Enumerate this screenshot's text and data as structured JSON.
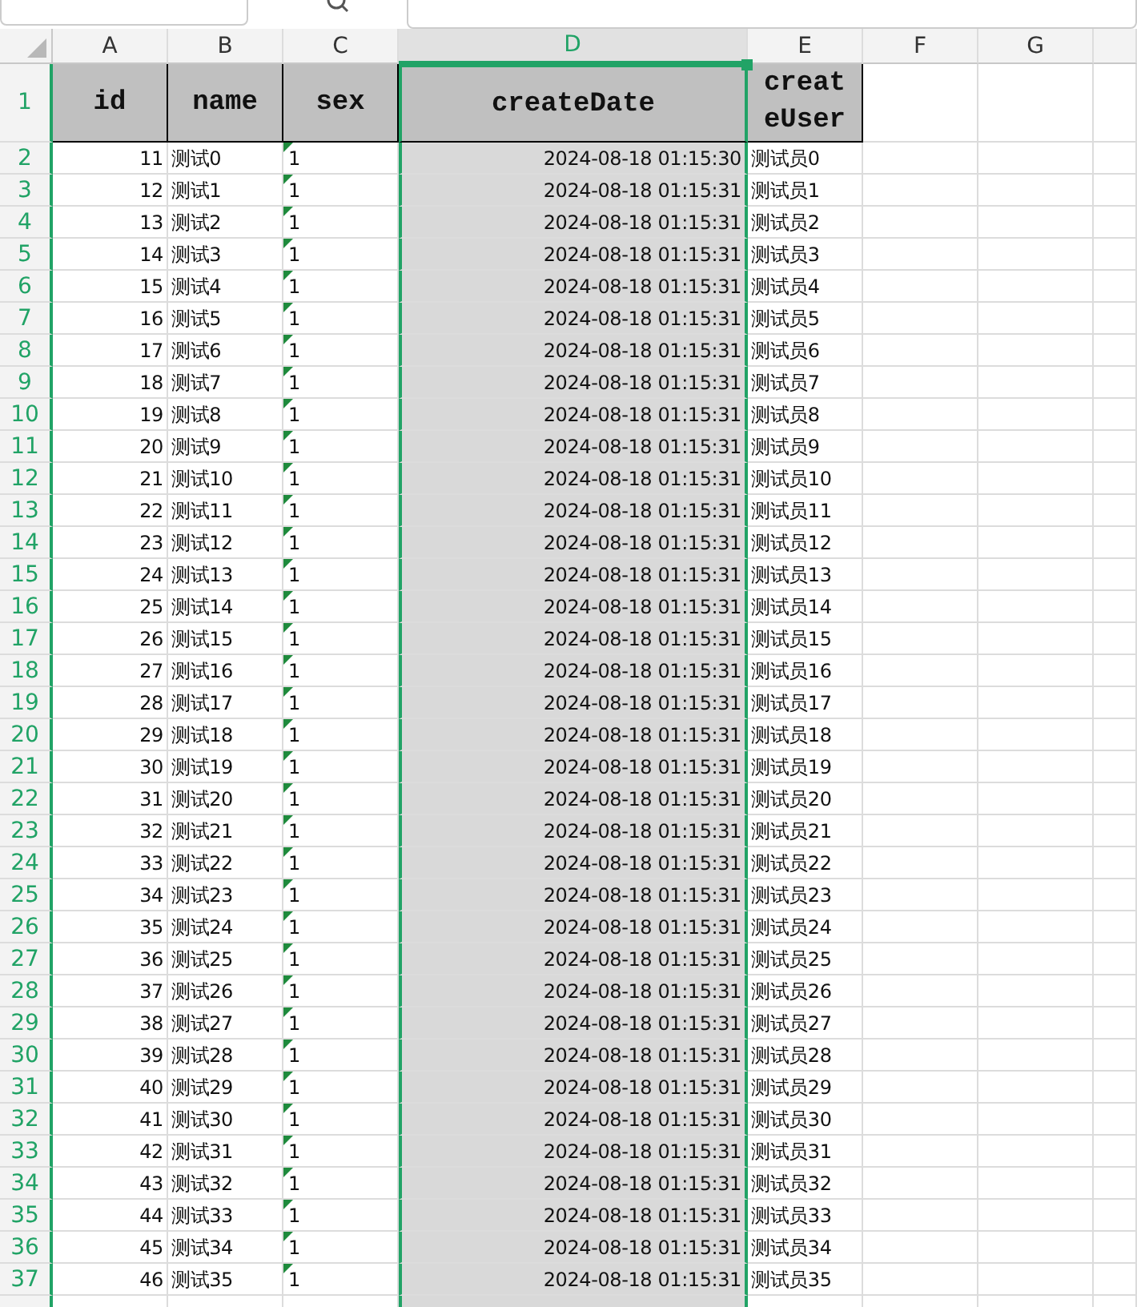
{
  "column_headers": [
    {
      "label": "A",
      "selected": false
    },
    {
      "label": "B",
      "selected": false
    },
    {
      "label": "C",
      "selected": false
    },
    {
      "label": "D",
      "selected": true
    },
    {
      "label": "E",
      "selected": false
    },
    {
      "label": "F",
      "selected": false
    },
    {
      "label": "G",
      "selected": false
    }
  ],
  "header_row": {
    "row_number": "1",
    "cells": [
      "id",
      "name",
      "sex",
      "createDate",
      "createUser"
    ]
  },
  "rows": [
    {
      "row_number": "2",
      "id": "11",
      "name": "测试0",
      "sex": "1",
      "sex_flagged": true,
      "createDate": "2024-08-18 01:15:30",
      "createUser": "测试员0"
    },
    {
      "row_number": "3",
      "id": "12",
      "name": "测试1",
      "sex": "1",
      "sex_flagged": true,
      "createDate": "2024-08-18 01:15:31",
      "createUser": "测试员1"
    },
    {
      "row_number": "4",
      "id": "13",
      "name": "测试2",
      "sex": "1",
      "sex_flagged": true,
      "createDate": "2024-08-18 01:15:31",
      "createUser": "测试员2"
    },
    {
      "row_number": "5",
      "id": "14",
      "name": "测试3",
      "sex": "1",
      "sex_flagged": true,
      "createDate": "2024-08-18 01:15:31",
      "createUser": "测试员3"
    },
    {
      "row_number": "6",
      "id": "15",
      "name": "测试4",
      "sex": "1",
      "sex_flagged": true,
      "createDate": "2024-08-18 01:15:31",
      "createUser": "测试员4"
    },
    {
      "row_number": "7",
      "id": "16",
      "name": "测试5",
      "sex": "1",
      "sex_flagged": true,
      "createDate": "2024-08-18 01:15:31",
      "createUser": "测试员5"
    },
    {
      "row_number": "8",
      "id": "17",
      "name": "测试6",
      "sex": "1",
      "sex_flagged": true,
      "createDate": "2024-08-18 01:15:31",
      "createUser": "测试员6"
    },
    {
      "row_number": "9",
      "id": "18",
      "name": "测试7",
      "sex": "1",
      "sex_flagged": true,
      "createDate": "2024-08-18 01:15:31",
      "createUser": "测试员7"
    },
    {
      "row_number": "10",
      "id": "19",
      "name": "测试8",
      "sex": "1",
      "sex_flagged": true,
      "createDate": "2024-08-18 01:15:31",
      "createUser": "测试员8"
    },
    {
      "row_number": "11",
      "id": "20",
      "name": "测试9",
      "sex": "1",
      "sex_flagged": true,
      "createDate": "2024-08-18 01:15:31",
      "createUser": "测试员9"
    },
    {
      "row_number": "12",
      "id": "21",
      "name": "测试10",
      "sex": "1",
      "sex_flagged": true,
      "createDate": "2024-08-18 01:15:31",
      "createUser": "测试员10"
    },
    {
      "row_number": "13",
      "id": "22",
      "name": "测试11",
      "sex": "1",
      "sex_flagged": true,
      "createDate": "2024-08-18 01:15:31",
      "createUser": "测试员11"
    },
    {
      "row_number": "14",
      "id": "23",
      "name": "测试12",
      "sex": "1",
      "sex_flagged": true,
      "createDate": "2024-08-18 01:15:31",
      "createUser": "测试员12"
    },
    {
      "row_number": "15",
      "id": "24",
      "name": "测试13",
      "sex": "1",
      "sex_flagged": true,
      "createDate": "2024-08-18 01:15:31",
      "createUser": "测试员13"
    },
    {
      "row_number": "16",
      "id": "25",
      "name": "测试14",
      "sex": "1",
      "sex_flagged": true,
      "createDate": "2024-08-18 01:15:31",
      "createUser": "测试员14"
    },
    {
      "row_number": "17",
      "id": "26",
      "name": "测试15",
      "sex": "1",
      "sex_flagged": true,
      "createDate": "2024-08-18 01:15:31",
      "createUser": "测试员15"
    },
    {
      "row_number": "18",
      "id": "27",
      "name": "测试16",
      "sex": "1",
      "sex_flagged": true,
      "createDate": "2024-08-18 01:15:31",
      "createUser": "测试员16"
    },
    {
      "row_number": "19",
      "id": "28",
      "name": "测试17",
      "sex": "1",
      "sex_flagged": true,
      "createDate": "2024-08-18 01:15:31",
      "createUser": "测试员17"
    },
    {
      "row_number": "20",
      "id": "29",
      "name": "测试18",
      "sex": "1",
      "sex_flagged": true,
      "createDate": "2024-08-18 01:15:31",
      "createUser": "测试员18"
    },
    {
      "row_number": "21",
      "id": "30",
      "name": "测试19",
      "sex": "1",
      "sex_flagged": true,
      "createDate": "2024-08-18 01:15:31",
      "createUser": "测试员19"
    },
    {
      "row_number": "22",
      "id": "31",
      "name": "测试20",
      "sex": "1",
      "sex_flagged": true,
      "createDate": "2024-08-18 01:15:31",
      "createUser": "测试员20"
    },
    {
      "row_number": "23",
      "id": "32",
      "name": "测试21",
      "sex": "1",
      "sex_flagged": true,
      "createDate": "2024-08-18 01:15:31",
      "createUser": "测试员21"
    },
    {
      "row_number": "24",
      "id": "33",
      "name": "测试22",
      "sex": "1",
      "sex_flagged": true,
      "createDate": "2024-08-18 01:15:31",
      "createUser": "测试员22"
    },
    {
      "row_number": "25",
      "id": "34",
      "name": "测试23",
      "sex": "1",
      "sex_flagged": true,
      "createDate": "2024-08-18 01:15:31",
      "createUser": "测试员23"
    },
    {
      "row_number": "26",
      "id": "35",
      "name": "测试24",
      "sex": "1",
      "sex_flagged": true,
      "createDate": "2024-08-18 01:15:31",
      "createUser": "测试员24"
    },
    {
      "row_number": "27",
      "id": "36",
      "name": "测试25",
      "sex": "1",
      "sex_flagged": true,
      "createDate": "2024-08-18 01:15:31",
      "createUser": "测试员25"
    },
    {
      "row_number": "28",
      "id": "37",
      "name": "测试26",
      "sex": "1",
      "sex_flagged": true,
      "createDate": "2024-08-18 01:15:31",
      "createUser": "测试员26"
    },
    {
      "row_number": "29",
      "id": "38",
      "name": "测试27",
      "sex": "1",
      "sex_flagged": true,
      "createDate": "2024-08-18 01:15:31",
      "createUser": "测试员27"
    },
    {
      "row_number": "30",
      "id": "39",
      "name": "测试28",
      "sex": "1",
      "sex_flagged": true,
      "createDate": "2024-08-18 01:15:31",
      "createUser": "测试员28"
    },
    {
      "row_number": "31",
      "id": "40",
      "name": "测试29",
      "sex": "1",
      "sex_flagged": true,
      "createDate": "2024-08-18 01:15:31",
      "createUser": "测试员29"
    },
    {
      "row_number": "32",
      "id": "41",
      "name": "测试30",
      "sex": "1",
      "sex_flagged": true,
      "createDate": "2024-08-18 01:15:31",
      "createUser": "测试员30"
    },
    {
      "row_number": "33",
      "id": "42",
      "name": "测试31",
      "sex": "1",
      "sex_flagged": true,
      "createDate": "2024-08-18 01:15:31",
      "createUser": "测试员31"
    },
    {
      "row_number": "34",
      "id": "43",
      "name": "测试32",
      "sex": "1",
      "sex_flagged": true,
      "createDate": "2024-08-18 01:15:31",
      "createUser": "测试员32"
    },
    {
      "row_number": "35",
      "id": "44",
      "name": "测试33",
      "sex": "1",
      "sex_flagged": true,
      "createDate": "2024-08-18 01:15:31",
      "createUser": "测试员33"
    },
    {
      "row_number": "36",
      "id": "45",
      "name": "测试34",
      "sex": "1",
      "sex_flagged": true,
      "createDate": "2024-08-18 01:15:31",
      "createUser": "测试员34"
    },
    {
      "row_number": "37",
      "id": "46",
      "name": "测试35",
      "sex": "1",
      "sex_flagged": true,
      "createDate": "2024-08-18 01:15:31",
      "createUser": "测试员35"
    }
  ]
}
